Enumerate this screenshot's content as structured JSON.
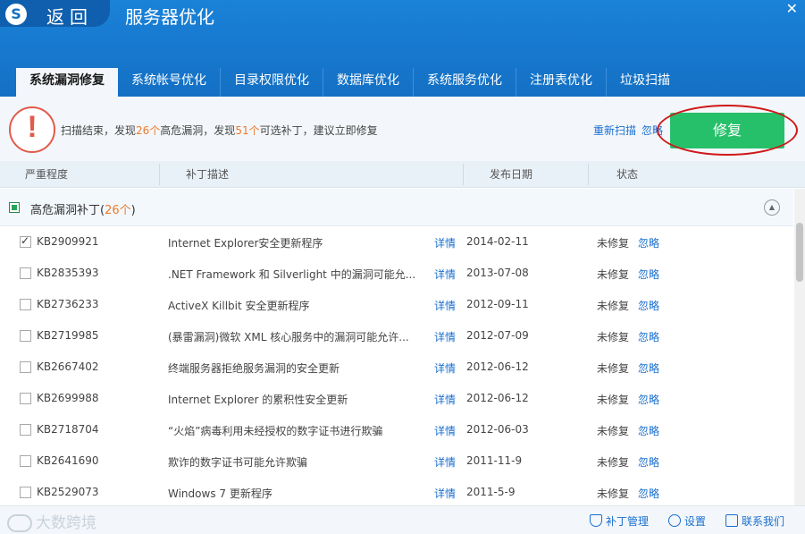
{
  "header": {
    "logo": "S",
    "back_label": "返回",
    "title": "服务器优化",
    "close_glyph": "✕"
  },
  "tabs": [
    {
      "label": "系统漏洞修复",
      "active": true
    },
    {
      "label": "系统帐号优化",
      "active": false
    },
    {
      "label": "目录权限优化",
      "active": false
    },
    {
      "label": "数据库优化",
      "active": false
    },
    {
      "label": "系统服务优化",
      "active": false
    },
    {
      "label": "注册表优化",
      "active": false
    },
    {
      "label": "垃圾扫描",
      "active": false
    }
  ],
  "status": {
    "text_a": "扫描结束，发现",
    "num_vuln": "26个",
    "text_b": "高危漏洞，发现",
    "num_patch": "51个",
    "text_c": "可选补丁，建议立即修复",
    "rescan_label": "重新扫描",
    "ignore_label": "忽略",
    "fix_label": "修复"
  },
  "columns": {
    "severity": "严重程度",
    "description": "补丁描述",
    "date": "发布日期",
    "state": "状态"
  },
  "group": {
    "label": "高危漏洞补丁(",
    "count": "26个",
    "close": ")"
  },
  "rows": [
    {
      "kb": "KB2909921",
      "desc": "Internet Explorer安全更新程序",
      "detail": "详情",
      "date": "2014-02-11",
      "state": "未修复",
      "ignore": "忽略",
      "checked": true
    },
    {
      "kb": "KB2835393",
      "desc": ".NET Framework 和 Silverlight 中的漏洞可能允...",
      "detail": "详情",
      "date": "2013-07-08",
      "state": "未修复",
      "ignore": "忽略",
      "checked": false
    },
    {
      "kb": "KB2736233",
      "desc": "ActiveX Killbit 安全更新程序",
      "detail": "详情",
      "date": "2012-09-11",
      "state": "未修复",
      "ignore": "忽略",
      "checked": false
    },
    {
      "kb": "KB2719985",
      "desc": "(暴雷漏洞)微软 XML 核心服务中的漏洞可能允许...",
      "detail": "详情",
      "date": "2012-07-09",
      "state": "未修复",
      "ignore": "忽略",
      "checked": false
    },
    {
      "kb": "KB2667402",
      "desc": "终端服务器拒绝服务漏洞的安全更新",
      "detail": "详情",
      "date": "2012-06-12",
      "state": "未修复",
      "ignore": "忽略",
      "checked": false
    },
    {
      "kb": "KB2699988",
      "desc": "Internet Explorer 的累积性安全更新",
      "detail": "详情",
      "date": "2012-06-12",
      "state": "未修复",
      "ignore": "忽略",
      "checked": false
    },
    {
      "kb": "KB2718704",
      "desc": "“火焰”病毒利用未经授权的数字证书进行欺骗",
      "detail": "详情",
      "date": "2012-06-03",
      "state": "未修复",
      "ignore": "忽略",
      "checked": false
    },
    {
      "kb": "KB2641690",
      "desc": "欺诈的数字证书可能允许欺骗",
      "detail": "详情",
      "date": "2011-11-9",
      "state": "未修复",
      "ignore": "忽略",
      "checked": false
    },
    {
      "kb": "KB2529073",
      "desc": "Windows 7 更新程序",
      "detail": "详情",
      "date": "2011-5-9",
      "state": "未修复",
      "ignore": "忽略",
      "checked": false
    }
  ],
  "footer": {
    "watermark": "大数跨境",
    "patch_mgmt": "补丁管理",
    "settings": "设置",
    "contact": "联系我们"
  }
}
